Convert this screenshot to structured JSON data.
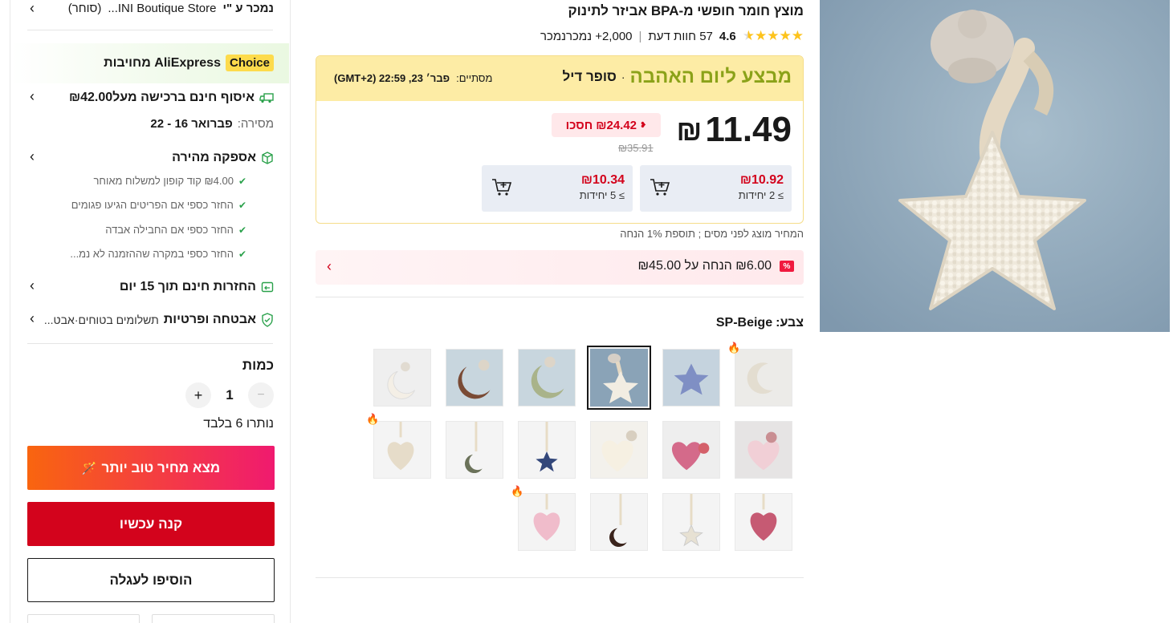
{
  "product": {
    "title": "מוצץ חומר חופשי מ-BPA אביזר לתינוק",
    "rating": "4.6",
    "reviews": "57 חוות דעת",
    "sold": "2,000+ נמכרנמכר",
    "stars_filled": 4.6
  },
  "deal": {
    "title": "מבצע ליום האהבה",
    "super": "סופר דיל",
    "ends_label": "מסתיים:",
    "ends_time": "פבר׳ 23, 22:59 (GMT+2)",
    "price": "11.49",
    "currency": "₪",
    "save_amount": "₪24.42",
    "save_label": "חסכו",
    "old_price": "₪35.91",
    "tier1_price": "₪10.92",
    "tier1_qty": "≥ 2 יחידות",
    "tier2_price": "₪10.34",
    "tier2_qty": "≥ 5 יחידות",
    "tax_note": "המחיר מוצג לפני מסים ; תוספת 1% הנחה",
    "coupon_text": "₪6.00 הנחה על ₪45.00",
    "coupon_badge": "%"
  },
  "color": {
    "label": "צבע:",
    "value": "SP-Beige"
  },
  "seller": {
    "sold_by": "נמכר ע \"י",
    "store": "INI Boutique Store...",
    "store_type": "(סוחר)"
  },
  "choice": {
    "badge": "Choice",
    "text": "AliExpress מחויבות"
  },
  "shipping": {
    "free_pickup": "איסוף חינם ברכישה מעל₪42.00",
    "delivery_label": "מסירה:",
    "delivery_dates": "פברואר 16 - 22"
  },
  "fast": {
    "title": "אספקה מהירה",
    "bullets": [
      "₪4.00 קוד קופון למשלוח מאוחר",
      "החזר כספי אם הפריטים הגיעו פגומים",
      "החזר כספי אם החבילה אבדה",
      "החזר כספי במקרה שההזמנה לא נמ..."
    ]
  },
  "returns": {
    "title": "החזרות חינם תוך 15 יום"
  },
  "security": {
    "title": "אבטחה ופרטיות",
    "sub": "תשלומים בטוחים·אבט..."
  },
  "quantity": {
    "label": "כמות",
    "value": "1",
    "minus": "−",
    "plus": "+",
    "remaining": "נותרו 6 בלבד"
  },
  "buttons": {
    "better_price": "מצא מחיר טוב יותר",
    "buy_now": "קנה עכשיו",
    "add_cart": "הוסיפו לעגלה"
  },
  "colors": {
    "accent_red": "#d3031c",
    "deal_yellow": "#fdeca5",
    "deal_green": "#8ba219",
    "gradient_start": "#f9650f",
    "gradient_end": "#f01a6f"
  },
  "icons": {
    "cart_plus": "cart-plus-icon",
    "truck": "truck-icon",
    "box": "box-icon",
    "return": "return-icon",
    "shield": "shield-icon",
    "fire": "fire-icon",
    "chevron": "chevron-icon"
  }
}
